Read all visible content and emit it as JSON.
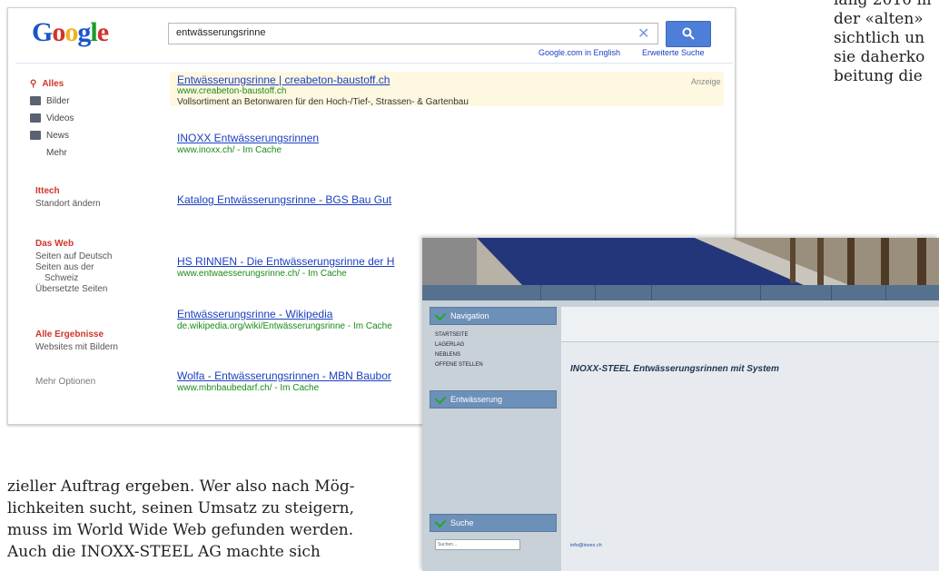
{
  "right_column_text": [
    "lang 2010 m",
    "der «alten»",
    "sichtlich un",
    "sie daherko",
    "beitung die"
  ],
  "bottom_text": [
    "zieller Auftrag ergeben. Wer also nach Mög-",
    "lichkeiten sucht, seinen Umsatz zu steigern,",
    "muss im World Wide Web gefunden werden.",
    "Auch die INOXX-STEEL AG machte sich"
  ],
  "google": {
    "logo_letters": [
      "G",
      "o",
      "o",
      "g",
      "l",
      "e"
    ],
    "query": "entwässerungsrinne",
    "stats": "",
    "link_english": "Google.com in English",
    "link_advanced": "Erweiterte Suche",
    "clear_icon": "close-icon",
    "search_button_icon": "search-icon",
    "sidebar": {
      "items": [
        {
          "label": "Alles",
          "icon": "search-icon",
          "active": true
        },
        {
          "label": "Bilder",
          "icon": "camera-icon",
          "active": false
        },
        {
          "label": "Videos",
          "icon": "video-icon",
          "active": false
        },
        {
          "label": "News",
          "icon": "news-icon",
          "active": false
        },
        {
          "label": "Mehr",
          "icon": "",
          "active": false
        }
      ],
      "location_head": "Ittech",
      "location_link": "Standort ändern",
      "web_head": "Das Web",
      "web_options": [
        "Seiten auf Deutsch",
        "Seiten aus der",
        "Schweiz",
        "Übersetzte Seiten"
      ],
      "all_results_head": "Alle Ergebnisse",
      "all_results_sub": "Websites mit Bildern",
      "more_options": "Mehr Optionen"
    },
    "ad_label": "Anzeige",
    "results": [
      {
        "title": "Entwässerungsrinne | creabeton-baustoff.ch",
        "url": "www.creabeton-baustoff.ch",
        "snippet": [
          "Vollsortiment an Betonwaren für den Hoch-/Tief-, Strassen- & Gartenbau"
        ]
      },
      {
        "title": "INOXX Entwässerungsrinnen",
        "url": "www.inoxx.ch/ - Im Cache",
        "snippet": [
          "",
          ""
        ]
      },
      {
        "title": "Katalog Entwässerungsrinne - BGS Bau Gut",
        "url": "",
        "snippet": [
          "",
          ""
        ]
      },
      {
        "title": "HS RINNEN - Die Entwässerungsrinne der H",
        "url": "www.entwaesserungsrinne.ch/ - Im Cache",
        "snippet": [
          ""
        ]
      },
      {
        "title": "Entwässerungsrinne - Wikipedia",
        "url": "de.wikipedia.org/wiki/Entwässerungsrinne - Im Cache",
        "snippet": [
          "",
          ""
        ]
      },
      {
        "title": "Wolfa - Entwässerungsrinnen - MBN Baubor",
        "url": "www.mbnbaubedarf.ch/ - Im Cache",
        "snippet": [
          "",
          ""
        ]
      }
    ]
  },
  "inoxx": {
    "nav": [
      "",
      "",
      "",
      "",
      "",
      ""
    ],
    "sidebar_boxes": [
      {
        "head": "Navigation",
        "items": [
          "STARTSEITE",
          "LAGERLAG",
          "NEBLENS",
          "OFFENE STELLEN"
        ]
      },
      {
        "head": "Entwässerung",
        "items": [
          "",
          "",
          "",
          "",
          "",
          "",
          ""
        ]
      },
      {
        "head": "Suche",
        "items": [
          "Suchen..."
        ]
      }
    ],
    "breadcrumb": "",
    "title": "INOXX-STEEL Entwässerungsrinnen mit System",
    "paragraphs": [
      "",
      "",
      "",
      "",
      "",
      "",
      "",
      "",
      "",
      "",
      "",
      "",
      "",
      "",
      "info@inoxx.ch"
    ]
  }
}
